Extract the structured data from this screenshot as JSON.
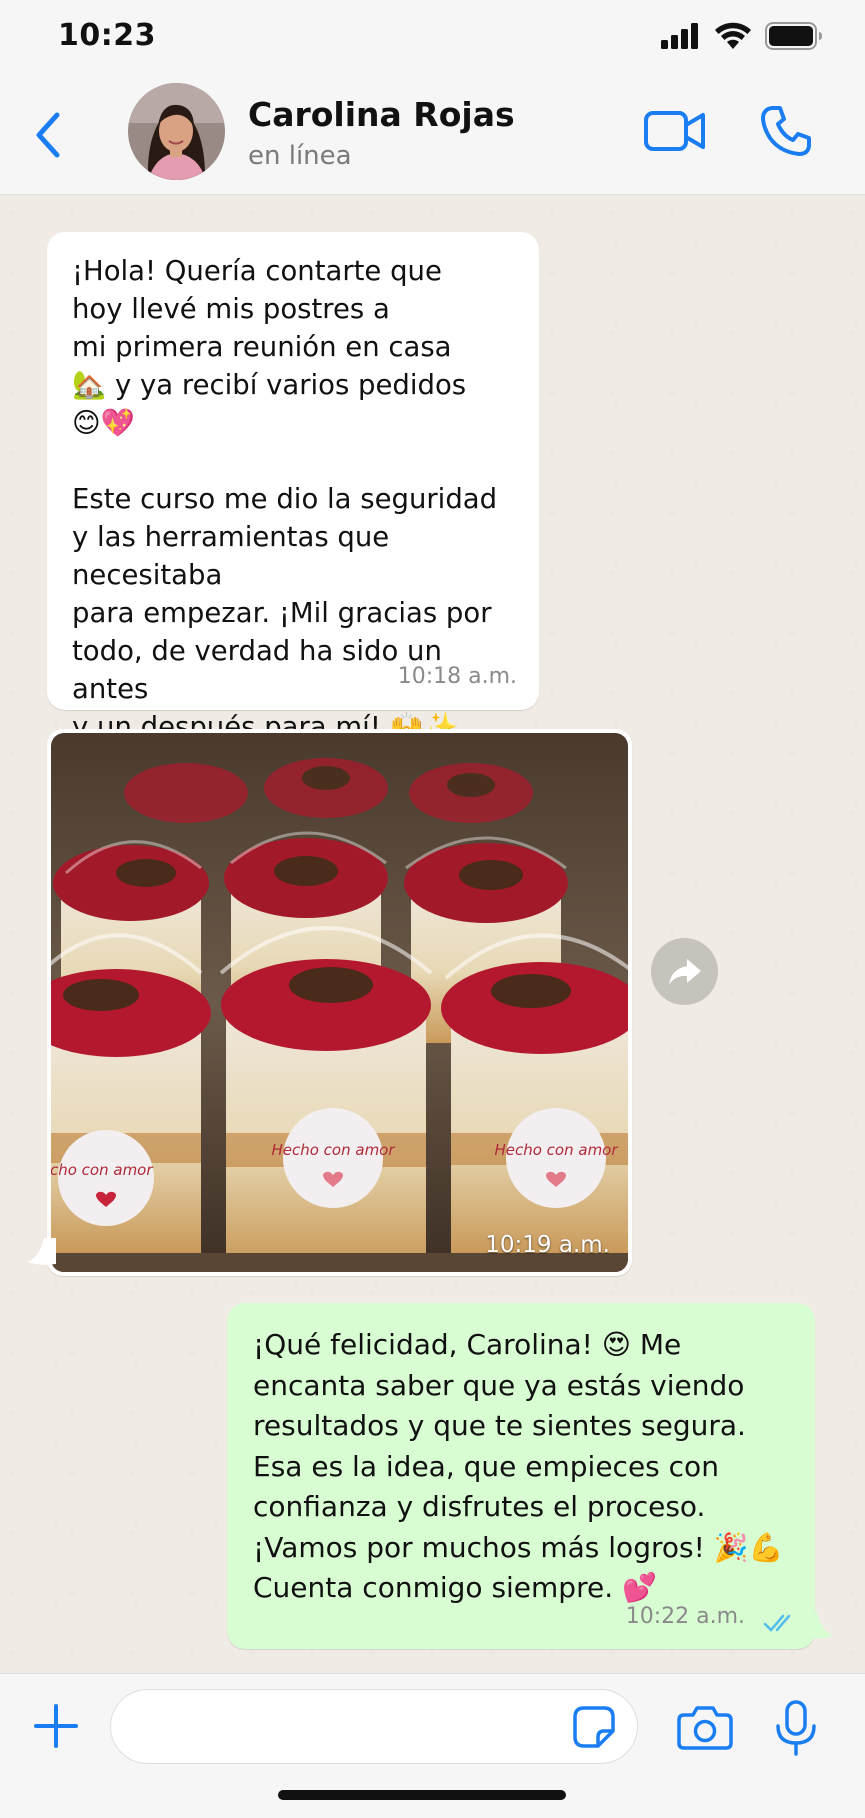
{
  "status_bar": {
    "time": "10:23"
  },
  "header": {
    "contact_name": "Carolina Rojas",
    "contact_status": "en línea"
  },
  "messages": [
    {
      "direction": "incoming",
      "text": "¡Hola! Quería contarte que\nhoy llevé mis postres a\nmi primera reunión en casa\n🏡 y ya recibí varios pedidos\n😊💖\n\nEste curso me dio la seguridad\ny las herramientas que necesitaba\npara empezar. ¡Mil gracias por\ntodo, de verdad ha sido un antes\ny un después para mí! 🙌✨",
      "time": "10:18 a.m."
    },
    {
      "direction": "incoming",
      "type": "image",
      "image_labels": [
        "Hecho con amor",
        "Hecho con amor",
        "Hecho con amor"
      ],
      "time": "10:19 a.m."
    },
    {
      "direction": "outgoing",
      "text": "¡Qué felicidad, Carolina! 😍 Me\nencanta saber que ya estás viendo\nresultados y que te sientes segura.\nEsa es la idea, que empieces con\nconfianza y disfrutes el proceso.\n¡Vamos por muchos más logros! 🎉💪\nCuenta conmigo siempre. 💕",
      "time": "10:22 a.m.",
      "read_status": "read"
    }
  ],
  "input_bar": {
    "placeholder": ""
  },
  "colors": {
    "accent": "#1a7ef2",
    "outgoing_bubble": "#d9fdd3",
    "incoming_bubble": "#ffffff",
    "read_ticks": "#53bdeb"
  },
  "icons": {
    "back": "chevron-left-icon",
    "video": "video-camera-icon",
    "call": "phone-icon",
    "forward": "forward-arrow-icon",
    "plus": "plus-icon",
    "sticker": "sticker-icon",
    "camera": "camera-icon",
    "mic": "microphone-icon"
  }
}
